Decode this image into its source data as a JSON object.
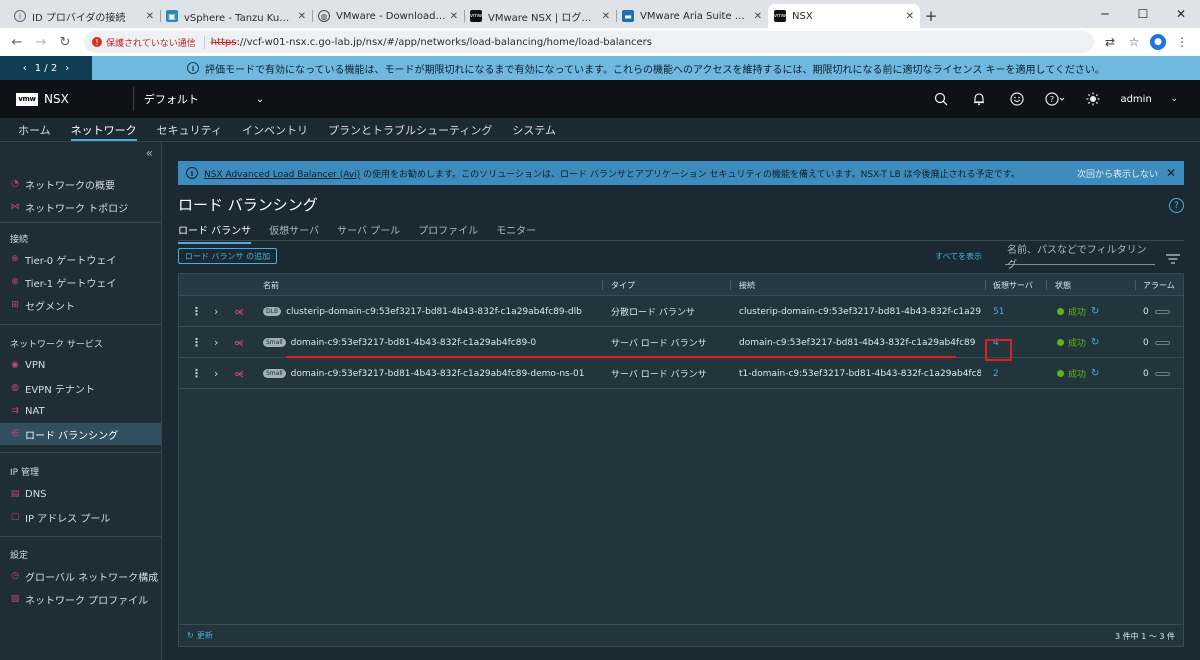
{
  "browser": {
    "tabs": [
      {
        "title": "ID プロバイダの接続",
        "active": false
      },
      {
        "title": "vSphere - Tanzu Kubernetes クラ",
        "active": false
      },
      {
        "title": "VMware - Download Kubernetes",
        "active": false
      },
      {
        "title": "VMware NSX | ログイン",
        "active": false
      },
      {
        "title": "VMware Aria Suite Lifecycle",
        "active": false
      },
      {
        "title": "NSX",
        "active": true
      }
    ],
    "new_tab": "+",
    "insecure_label": "保護されていない通信",
    "url_protocol": "https",
    "url_rest": "://vcf-w01-nsx.c.go-lab.jp/nsx/#/app/networks/load-balancing/home/load-balancers"
  },
  "eval_banner": {
    "pager": "1 / 2",
    "message": "評価モードで有効になっている機能は、モードが期限切れになるまで有効になっています。これらの機能へのアクセスを維持するには、期限切れになる前に適切なライセンス キーを適用してください。"
  },
  "header": {
    "logo": "vmw",
    "product": "NSX",
    "tenant": "デフォルト",
    "user": "admin"
  },
  "top_nav": [
    "ホーム",
    "ネットワーク",
    "セキュリティ",
    "インベントリ",
    "プランとトラブルシューティング",
    "システム"
  ],
  "top_nav_active": "ネットワーク",
  "sidebar": {
    "items_top": [
      "ネットワークの概要",
      "ネットワーク トポロジ"
    ],
    "sections": [
      {
        "title": "接続",
        "items": [
          "Tier-0 ゲートウェイ",
          "Tier-1 ゲートウェイ",
          "セグメント"
        ]
      },
      {
        "title": "ネットワーク サービス",
        "items": [
          "VPN",
          "EVPN テナント",
          "NAT",
          "ロード バランシング"
        ]
      },
      {
        "title": "IP 管理",
        "items": [
          "DNS",
          "IP アドレス プール"
        ]
      },
      {
        "title": "設定",
        "items": [
          "グローバル ネットワーク構成",
          "ネットワーク プロファイル"
        ]
      }
    ],
    "active_item": "ロード バランシング"
  },
  "alert": {
    "link_text": "NSX Advanced Load Balancer (Avi)",
    "text": " の使用をお勧めします。このソリューションは、ロード バランサとアプリケーション セキュリティの機能を備えています。NSX-T LB は今後廃止される予定です。",
    "dismiss": "次回から表示しない"
  },
  "page": {
    "title": "ロード バランシング",
    "subtabs": [
      "ロード バランサ",
      "仮想サーバ",
      "サーバ プール",
      "プロファイル",
      "モニター"
    ],
    "active_subtab": "ロード バランサ",
    "add_button": "ロード バランサ の追加",
    "show_all": "すべてを表示",
    "filter_placeholder": "名前、パスなどでフィルタリング"
  },
  "table": {
    "columns": [
      "名前",
      "タイプ",
      "接続",
      "仮想サーバ",
      "状態",
      "アラーム"
    ],
    "rows": [
      {
        "badge": "DLB",
        "name": "clusterip-domain-c9:53ef3217-bd81-4b43-832f-c1a29ab4fc89-dlb",
        "type": "分散ロード バランサ",
        "connection": "clusterip-domain-c9:53ef3217-bd81-4b43-832f-c1a29a...",
        "virtual_servers": "51",
        "status": "成功",
        "alarms": "0"
      },
      {
        "badge": "Small",
        "name": "domain-c9:53ef3217-bd81-4b43-832f-c1a29ab4fc89-0",
        "type": "サーバ ロード バランサ",
        "connection": "domain-c9:53ef3217-bd81-4b43-832f-c1a29ab4fc89",
        "virtual_servers": "4",
        "status": "成功",
        "alarms": "0"
      },
      {
        "badge": "Small",
        "name": "domain-c9:53ef3217-bd81-4b43-832f-c1a29ab4fc89-demo-ns-01",
        "type": "サーバ ロード バランサ",
        "connection": "t1-domain-c9:53ef3217-bd81-4b43-832f-c1a29ab4fc89...",
        "virtual_servers": "2",
        "status": "成功",
        "alarms": "0"
      }
    ],
    "refresh": "更新",
    "count": "3 件中 1 ～ 3 件"
  },
  "colors": {
    "accent": "#49afd9",
    "success": "#60b515",
    "highlight": "#e02020",
    "sidebar_icon": "#c9417f"
  }
}
